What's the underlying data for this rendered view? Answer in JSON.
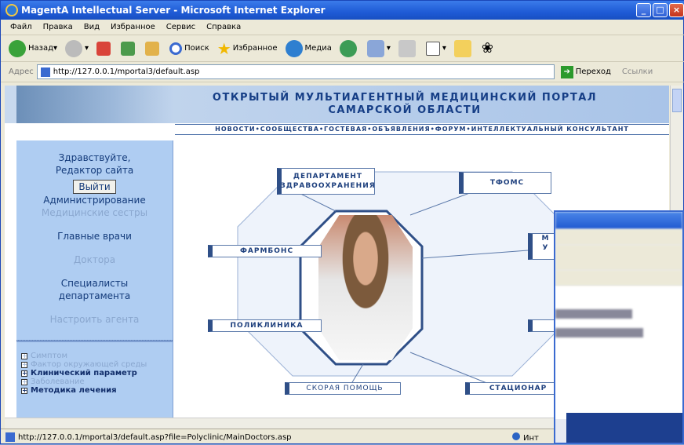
{
  "window": {
    "title": "MagentA Intellectual Server - Microsoft Internet Explorer"
  },
  "menu": [
    "Файл",
    "Правка",
    "Вид",
    "Избранное",
    "Сервис",
    "Справка"
  ],
  "toolbar": {
    "back": "Назад",
    "search": "Поиск",
    "favorites": "Избранное",
    "media": "Медиа"
  },
  "address": {
    "label": "Адрес",
    "url": "http://127.0.0.1/mportal3/default.asp",
    "go": "Переход",
    "links": "Ссылки"
  },
  "banner": {
    "line1": "ОТКРЫТЫЙ МУЛЬТИАГЕНТНЫЙ МЕДИЦИНСКИЙ ПОРТАЛ",
    "line2": "САМАРСКОЙ ОБЛАСТИ"
  },
  "nav": "НОВОСТИ•СООБЩЕСТВА•ГОСТЕВАЯ•ОБЪЯВЛЕНИЯ•ФОРУМ•ИНТЕЛЛЕКТУАЛЬНЫЙ КОНСУЛЬТАНТ",
  "sidebar": {
    "greeting1": "Здравствуйте,",
    "greeting2": "Редактор сайта",
    "exit": "Выйти",
    "admin": "Администрирование",
    "nurses": "Медицинские сестры",
    "chiefs": "Главные врачи",
    "doctors": "Доктора",
    "spec1": "Специалисты",
    "spec2": "департамента",
    "agent": "Настроить агента",
    "tree": [
      "Симптом",
      "Фактор окружающей среды",
      "Клинический параметр",
      "Заболевание",
      "Методика лечения"
    ]
  },
  "diagram": {
    "dept1": "ДЕПАРТАМЕНТ",
    "dept2": "ЗДРАВООХРАНЕНИЯ",
    "tfoms": "ТФОМС",
    "pharm": "ФАРМБОНС",
    "poly": "ПОЛИКЛИНИКА",
    "amb": "СКОРАЯ ПОМОЩЬ",
    "hosp": "СТАЦИОНАР",
    "right1": "М",
    "right2": "У"
  },
  "status": {
    "url": "http://127.0.0.1/mportal3/default.asp?file=Polyclinic/MainDoctors.asp",
    "zone": "Инт"
  }
}
